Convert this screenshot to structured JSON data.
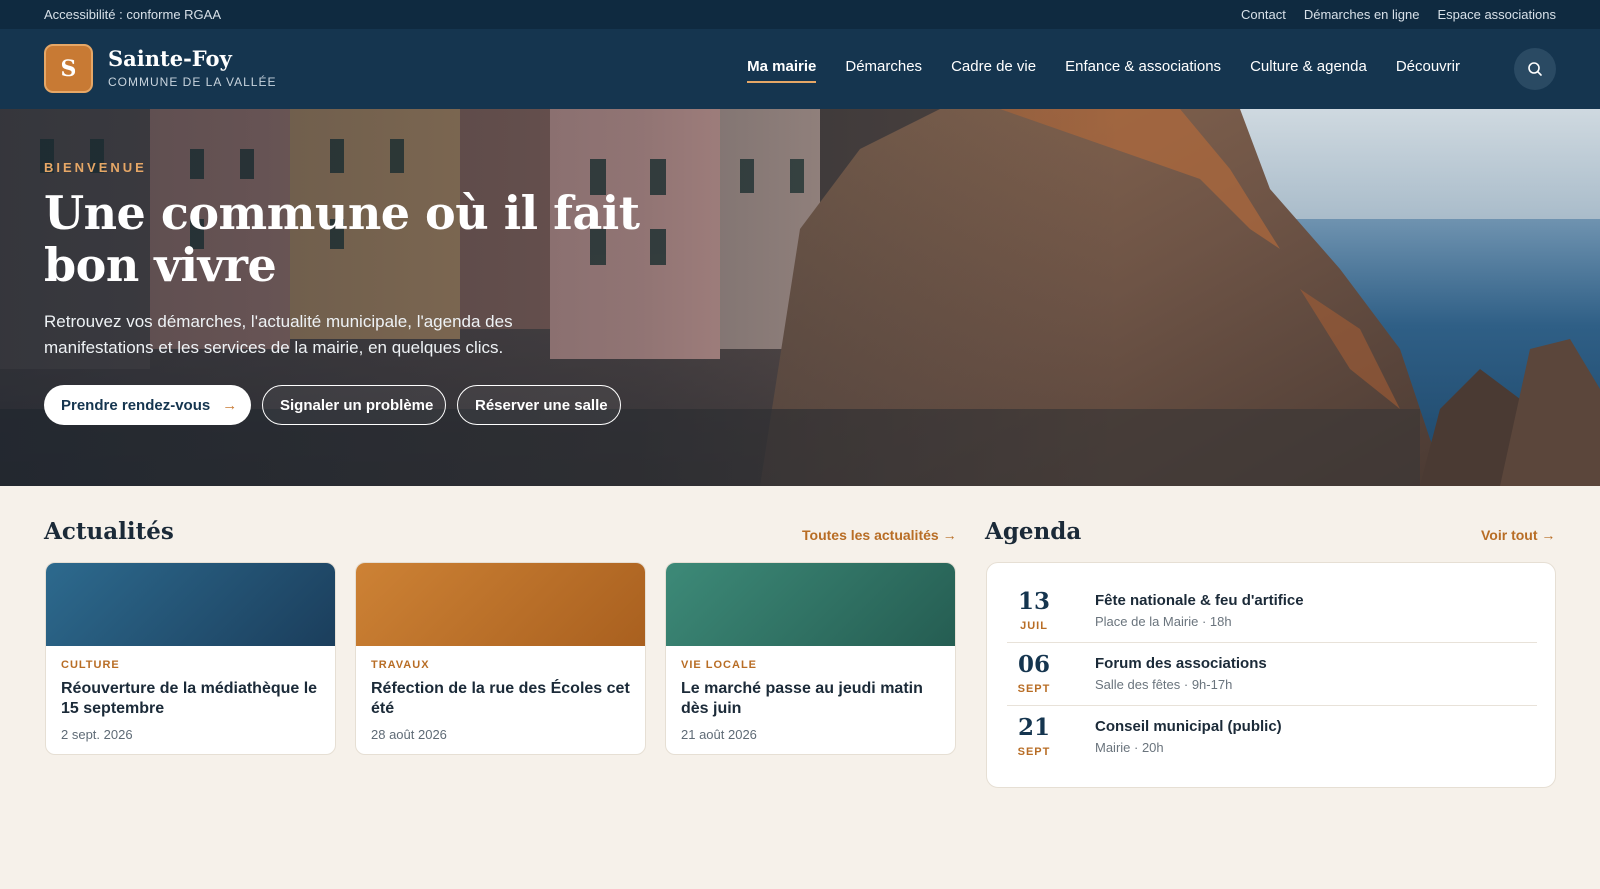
{
  "topbar": {
    "accessibility": "Accessibilité : conforme RGAA",
    "links": [
      "Contact",
      "Démarches en ligne",
      "Espace associations"
    ]
  },
  "header": {
    "logo_letter": "S",
    "name": "Sainte-Foy",
    "subtitle": "COMMUNE DE LA VALLÉE",
    "nav": [
      "Ma mairie",
      "Démarches",
      "Cadre de vie",
      "Enfance & associations",
      "Culture & agenda",
      "Découvrir"
    ],
    "active_nav": "Ma mairie",
    "search_icon": "search-icon"
  },
  "hero": {
    "eyebrow": "BIENVENUE",
    "title": "Une commune où il fait bon vivre",
    "text": "Retrouvez vos démarches, l'actualité municipale, l'agenda des manifestations et les services de la mairie, en quelques clics.",
    "primary_button": "Prendre rendez-vous",
    "primary_arrow": "→",
    "button_2": "Signaler un problème",
    "button_3": "Réserver une salle"
  },
  "news": {
    "title": "Actualités",
    "link": "Toutes les actualités →",
    "items": [
      {
        "category": "CULTURE",
        "title": "Réouverture de la médiathèque le 15 septembre",
        "date": "2 sept. 2026",
        "color_from": "#2d6a8e",
        "color_to": "#1b3e5c"
      },
      {
        "category": "TRAVAUX",
        "title": "Réfection de la rue des Écoles cet été",
        "date": "28 août 2026",
        "color_from": "#cd8235",
        "color_to": "#a9601f"
      },
      {
        "category": "VIE LOCALE",
        "title": "Le marché passe au jeudi matin dès juin",
        "date": "21 août 2026",
        "color_from": "#3d8a78",
        "color_to": "#255d52"
      }
    ]
  },
  "agenda": {
    "title": "Agenda",
    "link": "Voir tout →",
    "events": [
      {
        "day": "13",
        "month": "JUIL",
        "title": "Fête nationale & feu d'artifice",
        "meta": "Place de la Mairie · 18h"
      },
      {
        "day": "06",
        "month": "SEPT",
        "title": "Forum des associations",
        "meta": "Salle des fêtes · 9h-17h"
      },
      {
        "day": "21",
        "month": "SEPT",
        "title": "Conseil municipal (public)",
        "meta": "Mairie · 20h"
      }
    ]
  }
}
